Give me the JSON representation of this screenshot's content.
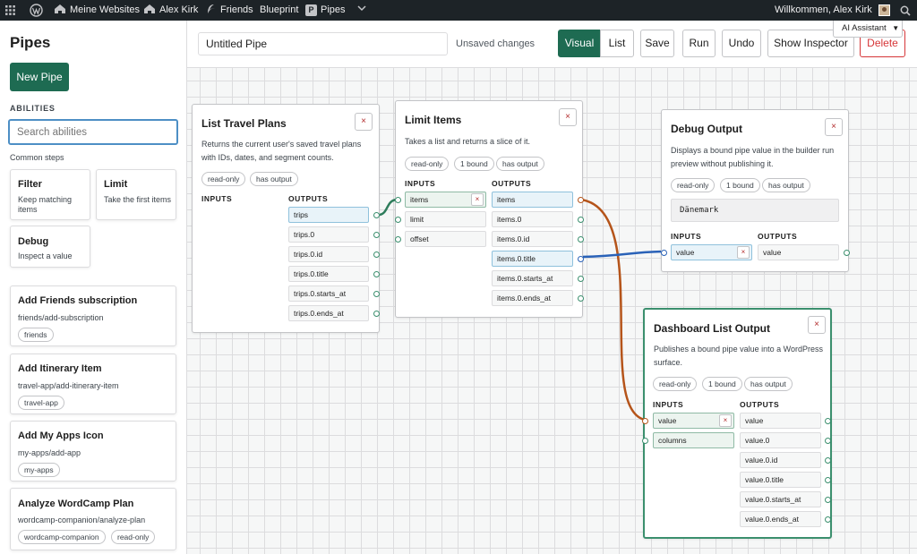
{
  "admin_bar": {
    "my_sites": "Meine Websites",
    "site_user": "Alex Kirk",
    "friends": "Friends",
    "blueprint": "Blueprint",
    "pipes": "Pipes",
    "pipes_badge": "P",
    "welcome": "Willkommen, Alex Kirk"
  },
  "ai_assistant": {
    "label": "AI Assistant",
    "caret": "▼"
  },
  "sidebar": {
    "title": "Pipes",
    "new_pipe": "New Pipe",
    "abilities_heading": "ABILITIES",
    "search_placeholder": "Search abilities",
    "common_steps_label": "Common steps",
    "steps": [
      {
        "title": "Filter",
        "desc": "Keep matching items"
      },
      {
        "title": "Limit",
        "desc": "Take the first items"
      },
      {
        "title": "Debug",
        "desc": "Inspect a value"
      }
    ],
    "abilities": [
      {
        "title": "Add Friends subscription",
        "slug": "friends/add-subscription",
        "tags": [
          "friends"
        ]
      },
      {
        "title": "Add Itinerary Item",
        "slug": "travel-app/add-itinerary-item",
        "tags": [
          "travel-app"
        ]
      },
      {
        "title": "Add My Apps Icon",
        "slug": "my-apps/add-app",
        "tags": [
          "my-apps"
        ]
      },
      {
        "title": "Analyze WordCamp Plan",
        "slug": "wordcamp-companion/analyze-plan",
        "tags": [
          "wordcamp-companion",
          "read-only"
        ]
      }
    ]
  },
  "toolbar": {
    "pipe_name": "Untitled Pipe",
    "status": "Unsaved changes",
    "view_visual": "Visual",
    "view_list": "List",
    "save": "Save",
    "run": "Run",
    "undo": "Undo",
    "show_inspector": "Show Inspector",
    "delete": "Delete"
  },
  "labels": {
    "inputs": "INPUTS",
    "outputs": "OUTPUTS",
    "remove": "×"
  },
  "nodes": {
    "travel": {
      "title": "List Travel Plans",
      "desc": "Returns the current user's saved travel plans with IDs, dates, and segment counts.",
      "tags": [
        "read-only",
        "has output"
      ],
      "outputs": [
        "trips",
        "trips.0",
        "trips.0.id",
        "trips.0.title",
        "trips.0.starts_at",
        "trips.0.ends_at"
      ]
    },
    "limit": {
      "title": "Limit Items",
      "desc": "Takes a list and returns a slice of it.",
      "tags": [
        "read-only",
        "1 bound",
        "has output"
      ],
      "inputs": [
        "items",
        "limit",
        "offset"
      ],
      "outputs": [
        "items",
        "items.0",
        "items.0.id",
        "items.0.title",
        "items.0.starts_at",
        "items.0.ends_at"
      ]
    },
    "debug": {
      "title": "Debug Output",
      "desc": "Displays a bound pipe value in the builder run preview without publishing it.",
      "tags": [
        "read-only",
        "1 bound",
        "has output"
      ],
      "preview": "Dänemark",
      "inputs": [
        "value"
      ],
      "outputs": [
        "value"
      ]
    },
    "dashboard": {
      "title": "Dashboard List Output",
      "desc": "Publishes a bound pipe value into a WordPress surface.",
      "tags": [
        "read-only",
        "1 bound",
        "has output"
      ],
      "inputs": [
        "value",
        "columns"
      ],
      "outputs": [
        "value",
        "value.0",
        "value.0.id",
        "value.0.title",
        "value.0.starts_at",
        "value.0.ends_at"
      ]
    }
  },
  "colors": {
    "accent": "#1e6b52",
    "delete": "#b32d2e",
    "wire_green": "#2f7d5c",
    "wire_orange": "#b5541a",
    "wire_blue": "#2a62b8"
  }
}
